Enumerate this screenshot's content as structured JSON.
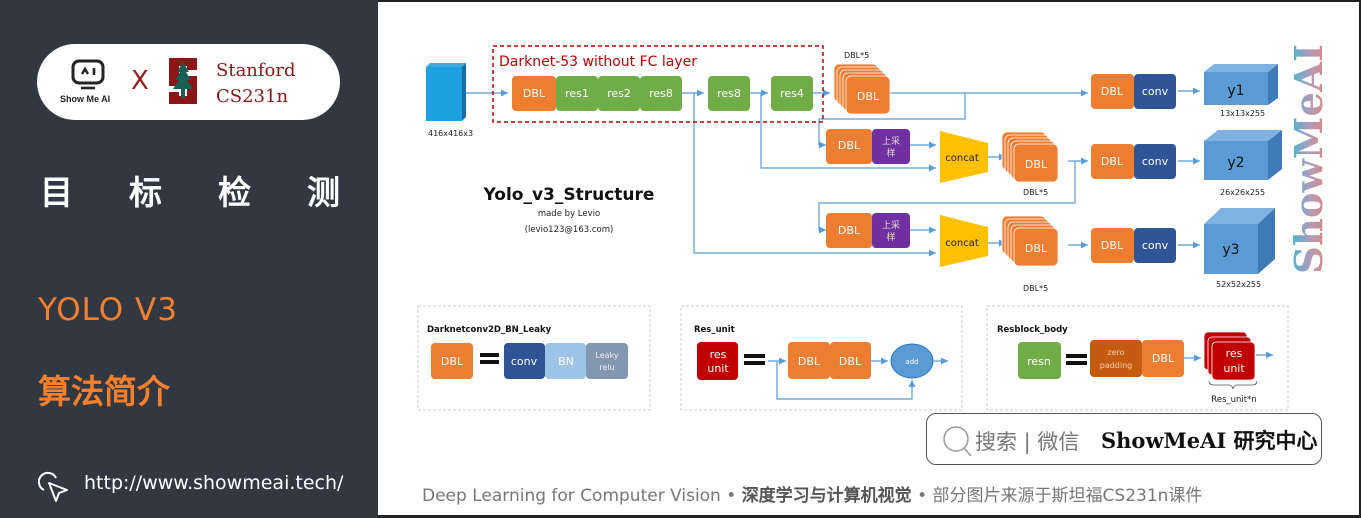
{
  "sidebar": {
    "logo_text": "Show Me AI",
    "x_mark": "X",
    "partner_line1": "Stanford",
    "partner_line2": "CS231n",
    "topic_chars": [
      "目",
      "标",
      "检",
      "测"
    ],
    "section_title": "YOLO V3",
    "section_subtitle": "算法简介",
    "url": "http://www.showmeai.tech/"
  },
  "diagram": {
    "title": "Yolo_v3_Structure",
    "author": "made by Levio",
    "email": "(levio123@163.com)",
    "backbone_label": "Darknet-53 without FC layer",
    "input_size": "416x416x3",
    "backbone_blocks": [
      "DBL",
      "res1",
      "res2",
      "res8"
    ],
    "res8_2": "res8",
    "res4": "res4",
    "dbl": "DBL",
    "dbl5": "DBL*5",
    "conv": "conv",
    "upsample": "上采样",
    "upsample_l1": "上采",
    "upsample_l2": "样",
    "concat": "concat",
    "outputs": [
      {
        "name": "y1",
        "size": "13x13x255"
      },
      {
        "name": "y2",
        "size": "26x26x255"
      },
      {
        "name": "y3",
        "size": "52x52x255"
      }
    ],
    "legend_dbl": {
      "title": "Darknetconv2D_BN_Leaky",
      "lhs": "DBL",
      "parts": [
        "conv",
        "BN",
        "Leaky relu"
      ]
    },
    "legend_res_unit": {
      "title": "Res_unit",
      "lhs_l1": "res",
      "lhs_l2": "unit",
      "parts": [
        "DBL",
        "DBL"
      ],
      "add": "add"
    },
    "legend_resblock": {
      "title": "Resblock_body",
      "lhs": "resn",
      "pad_l1": "zero",
      "pad_l2": "padding",
      "dbl": "DBL",
      "unit_l1": "res",
      "unit_l2": "unit",
      "caption": "Res_unit*n"
    },
    "colors": {
      "dbl": "#ed7d31",
      "res": "#70ad47",
      "conv": "#2f5597",
      "upsample": "#7030a0",
      "concat": "#ffc000",
      "output": "#5b9bd5",
      "bn": "#9dc3e6",
      "leaky": "#8497b0",
      "res_unit": "#c00000",
      "zero_pad": "#c55a11",
      "backbone_border": "#c00000",
      "arrow": "#5b9bd5"
    }
  },
  "search": {
    "label": "搜索 | 微信",
    "brand": "ShowMeAI 研究中心"
  },
  "footer": {
    "part1": "Deep Learning for Computer Vision",
    "sep": " • ",
    "part2": "深度学习与计算机视觉",
    "part3": "部分图片来源于斯坦福CS231n课件"
  },
  "watermark": "ShowMeAI"
}
